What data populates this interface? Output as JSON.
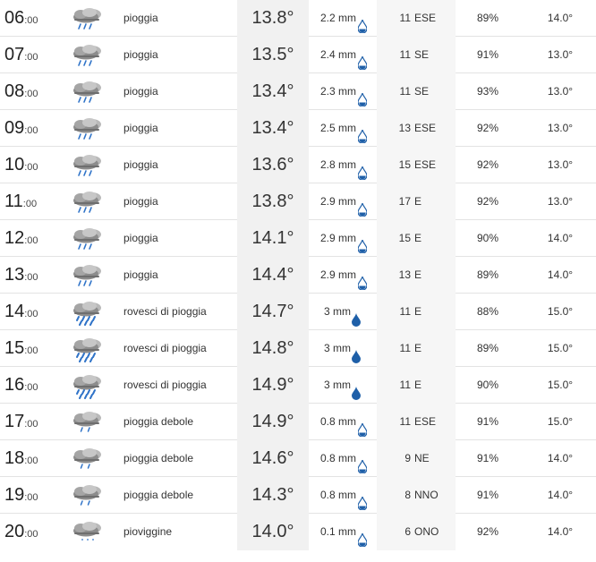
{
  "rows": [
    {
      "hour": "06",
      "min": ":00",
      "icon": "rain-cloud-icon",
      "desc": "pioggia",
      "temp": "13.8°",
      "rain": "2.2 mm",
      "wind_speed": "11",
      "wind_dir": "ESE",
      "humidity": "89%",
      "perceived": "14.0°"
    },
    {
      "hour": "07",
      "min": ":00",
      "icon": "rain-cloud-icon",
      "desc": "pioggia",
      "temp": "13.5°",
      "rain": "2.4 mm",
      "wind_speed": "11",
      "wind_dir": "SE",
      "humidity": "91%",
      "perceived": "13.0°"
    },
    {
      "hour": "08",
      "min": ":00",
      "icon": "rain-cloud-icon",
      "desc": "pioggia",
      "temp": "13.4°",
      "rain": "2.3 mm",
      "wind_speed": "11",
      "wind_dir": "SE",
      "humidity": "93%",
      "perceived": "13.0°"
    },
    {
      "hour": "09",
      "min": ":00",
      "icon": "rain-cloud-icon",
      "desc": "pioggia",
      "temp": "13.4°",
      "rain": "2.5 mm",
      "wind_speed": "13",
      "wind_dir": "ESE",
      "humidity": "92%",
      "perceived": "13.0°"
    },
    {
      "hour": "10",
      "min": ":00",
      "icon": "rain-cloud-icon",
      "desc": "pioggia",
      "temp": "13.6°",
      "rain": "2.8 mm",
      "wind_speed": "15",
      "wind_dir": "ESE",
      "humidity": "92%",
      "perceived": "13.0°"
    },
    {
      "hour": "11",
      "min": ":00",
      "icon": "rain-cloud-icon",
      "desc": "pioggia",
      "temp": "13.8°",
      "rain": "2.9 mm",
      "wind_speed": "17",
      "wind_dir": "E",
      "humidity": "92%",
      "perceived": "13.0°"
    },
    {
      "hour": "12",
      "min": ":00",
      "icon": "rain-cloud-icon",
      "desc": "pioggia",
      "temp": "14.1°",
      "rain": "2.9 mm",
      "wind_speed": "15",
      "wind_dir": "E",
      "humidity": "90%",
      "perceived": "14.0°"
    },
    {
      "hour": "13",
      "min": ":00",
      "icon": "rain-cloud-icon",
      "desc": "pioggia",
      "temp": "14.4°",
      "rain": "2.9 mm",
      "wind_speed": "13",
      "wind_dir": "E",
      "humidity": "89%",
      "perceived": "14.0°"
    },
    {
      "hour": "14",
      "min": ":00",
      "icon": "heavy-rain-cloud-icon",
      "desc": "rovesci di pioggia",
      "temp": "14.7°",
      "rain": "3 mm",
      "wind_speed": "11",
      "wind_dir": "E",
      "humidity": "88%",
      "perceived": "15.0°"
    },
    {
      "hour": "15",
      "min": ":00",
      "icon": "heavy-rain-cloud-icon",
      "desc": "rovesci di pioggia",
      "temp": "14.8°",
      "rain": "3 mm",
      "wind_speed": "11",
      "wind_dir": "E",
      "humidity": "89%",
      "perceived": "15.0°"
    },
    {
      "hour": "16",
      "min": ":00",
      "icon": "heavy-rain-cloud-icon",
      "desc": "rovesci di pioggia",
      "temp": "14.9°",
      "rain": "3 mm",
      "wind_speed": "11",
      "wind_dir": "E",
      "humidity": "90%",
      "perceived": "15.0°"
    },
    {
      "hour": "17",
      "min": ":00",
      "icon": "light-rain-cloud-icon",
      "desc": "pioggia debole",
      "temp": "14.9°",
      "rain": "0.8 mm",
      "wind_speed": "11",
      "wind_dir": "ESE",
      "humidity": "91%",
      "perceived": "15.0°"
    },
    {
      "hour": "18",
      "min": ":00",
      "icon": "light-rain-cloud-icon",
      "desc": "pioggia debole",
      "temp": "14.6°",
      "rain": "0.8 mm",
      "wind_speed": "9",
      "wind_dir": "NE",
      "humidity": "91%",
      "perceived": "14.0°"
    },
    {
      "hour": "19",
      "min": ":00",
      "icon": "light-rain-cloud-icon",
      "desc": "pioggia debole",
      "temp": "14.3°",
      "rain": "0.8 mm",
      "wind_speed": "8",
      "wind_dir": "NNO",
      "humidity": "91%",
      "perceived": "14.0°"
    },
    {
      "hour": "20",
      "min": ":00",
      "icon": "drizzle-cloud-icon",
      "desc": "pioviggine",
      "temp": "14.0°",
      "rain": "0.1 mm",
      "wind_speed": "6",
      "wind_dir": "ONO",
      "humidity": "92%",
      "perceived": "14.0°"
    }
  ],
  "colors": {
    "drop": "#1e5fa8",
    "cloud": "#8c8c8c",
    "rain_blue": "#2f73c8"
  }
}
